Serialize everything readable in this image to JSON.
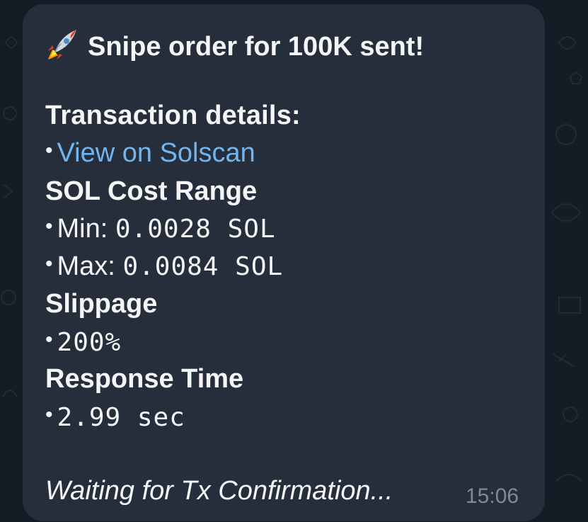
{
  "message": {
    "title": "Snipe order for 100K sent!",
    "tx_details_label": "Transaction details:",
    "view_link": "View on Solscan",
    "cost_range_label": "SOL Cost Range",
    "min_label": "Min:",
    "min_value": "0.0028 SOL",
    "max_label": "Max:",
    "max_value": "0.0084 SOL",
    "slippage_label": "Slippage",
    "slippage_value": "200%",
    "response_time_label": "Response Time",
    "response_time_value": "2.99 sec",
    "status_text": "Waiting for Tx Confirmation...",
    "timestamp": "15:06",
    "bullet": "•"
  },
  "icons": {
    "title_icon": "rocket-icon"
  },
  "colors": {
    "background": "#161c25",
    "bubble": "#252e3a",
    "text": "#f3f5f7",
    "link": "#74b4ec",
    "timestamp": "#7f8894"
  }
}
